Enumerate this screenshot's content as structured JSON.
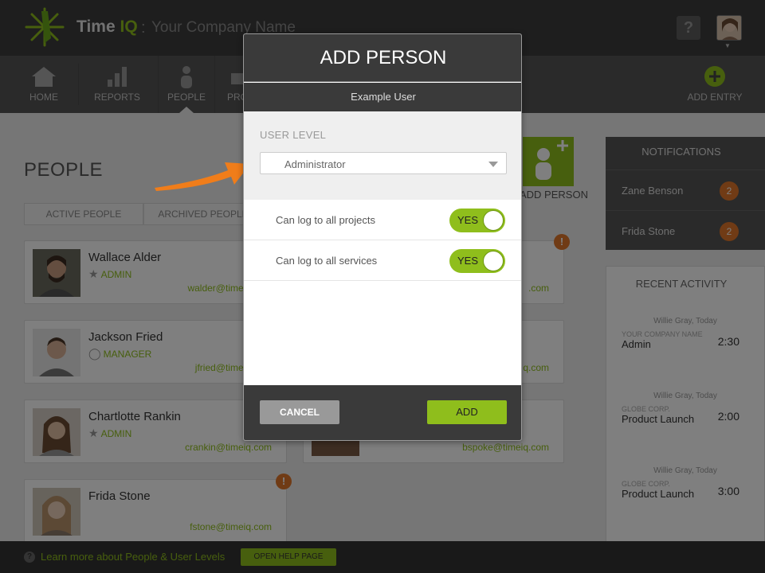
{
  "header": {
    "brand_time": "Time",
    "brand_iq": "IQ",
    "brand_sep": ":",
    "company": "Your Company Name",
    "help_icon": "?"
  },
  "nav": {
    "items": [
      {
        "label": "HOME",
        "icon": "home-icon"
      },
      {
        "label": "REPORTS",
        "icon": "bar-chart-icon"
      },
      {
        "label": "PEOPLE",
        "icon": "person-icon"
      },
      {
        "label": "PRO",
        "icon": "briefcase-icon"
      }
    ],
    "add_entry": "ADD ENTRY"
  },
  "page": {
    "title": "PEOPLE",
    "tabs": [
      "ACTIVE PEOPLE",
      "ARCHIVED PEOPLE"
    ],
    "add_person_label": "ADD PERSON",
    "people": [
      {
        "name": "Wallace Alder",
        "role": "ADMIN",
        "role_icon": "star-icon",
        "email": "walder@timeiq.com"
      },
      {
        "name": "Jackson Fried",
        "role": "MANAGER",
        "role_icon": "circle-icon",
        "email": "jfried@timeiq.com"
      },
      {
        "name": "Chartlotte Rankin",
        "role": "ADMIN",
        "role_icon": "star-icon",
        "email": "crankin@timeiq.com"
      },
      {
        "name": "Frida Stone",
        "role": "",
        "role_icon": "",
        "email": "fstone@timeiq.com"
      }
    ],
    "right_col_emails": [
      ".com",
      "q.com",
      "bspoke@timeiq.com"
    ],
    "alert_icon": "!"
  },
  "notifications": {
    "title": "NOTIFICATIONS",
    "items": [
      {
        "name": "Zane Benson",
        "count": "2"
      },
      {
        "name": "Frida Stone",
        "count": "2"
      }
    ]
  },
  "recent": {
    "title": "RECENT ACTIVITY",
    "items": [
      {
        "who": "Willie Gray, Today",
        "org": "YOUR COMPANY NAME",
        "project": "Admin",
        "duration": "2:30"
      },
      {
        "who": "Willie Gray, Today",
        "org": "GLOBE CORP.",
        "project": "Product Launch",
        "duration": "2:00"
      },
      {
        "who": "Willie Gray, Today",
        "org": "GLOBE CORP.",
        "project": "Product Launch",
        "duration": "3:00"
      }
    ]
  },
  "footer": {
    "text": "Learn more about People & User Levels",
    "button": "OPEN HELP PAGE"
  },
  "modal": {
    "title": "ADD PERSON",
    "subtitle": "Example User",
    "level_label": "USER LEVEL",
    "level_value": "Administrator",
    "permissions": [
      {
        "label": "Can log to all projects",
        "toggle": "YES",
        "on": true
      },
      {
        "label": "Can log to all services",
        "toggle": "YES",
        "on": true
      }
    ],
    "cancel": "CANCEL",
    "add": "ADD"
  },
  "colors": {
    "accent": "#8fbe1c",
    "alert": "#e0772a",
    "dark": "#3a3a3a",
    "arrow": "#f07d1a"
  }
}
